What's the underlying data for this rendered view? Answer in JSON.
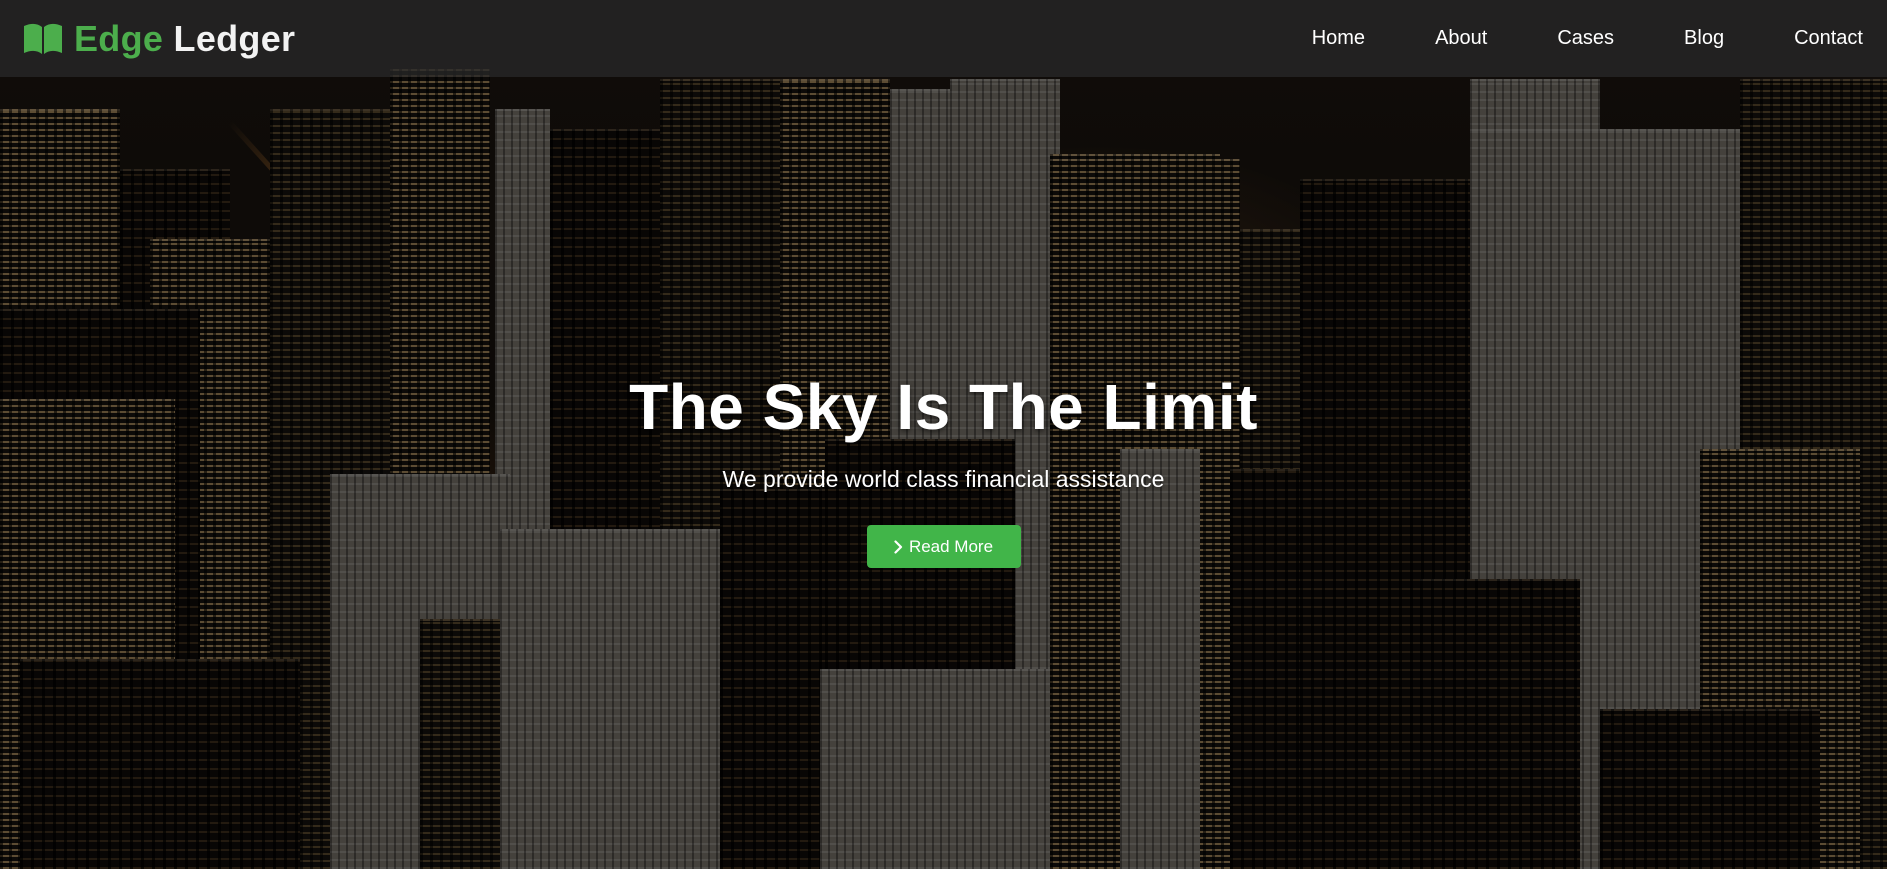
{
  "brand": {
    "name_part1": "Edge",
    "name_part2": "Ledger",
    "icon": "open-book-icon",
    "accent_color": "#4cae4c"
  },
  "nav": {
    "items": [
      {
        "label": "Home"
      },
      {
        "label": "About"
      },
      {
        "label": "Cases"
      },
      {
        "label": "Blog"
      },
      {
        "label": "Contact"
      }
    ]
  },
  "hero": {
    "title": "The Sky Is The Limit",
    "subtitle": "We provide world class financial assistance",
    "button_label": "Read More",
    "button_icon": "chevron-right-icon",
    "button_color": "#41b549"
  }
}
